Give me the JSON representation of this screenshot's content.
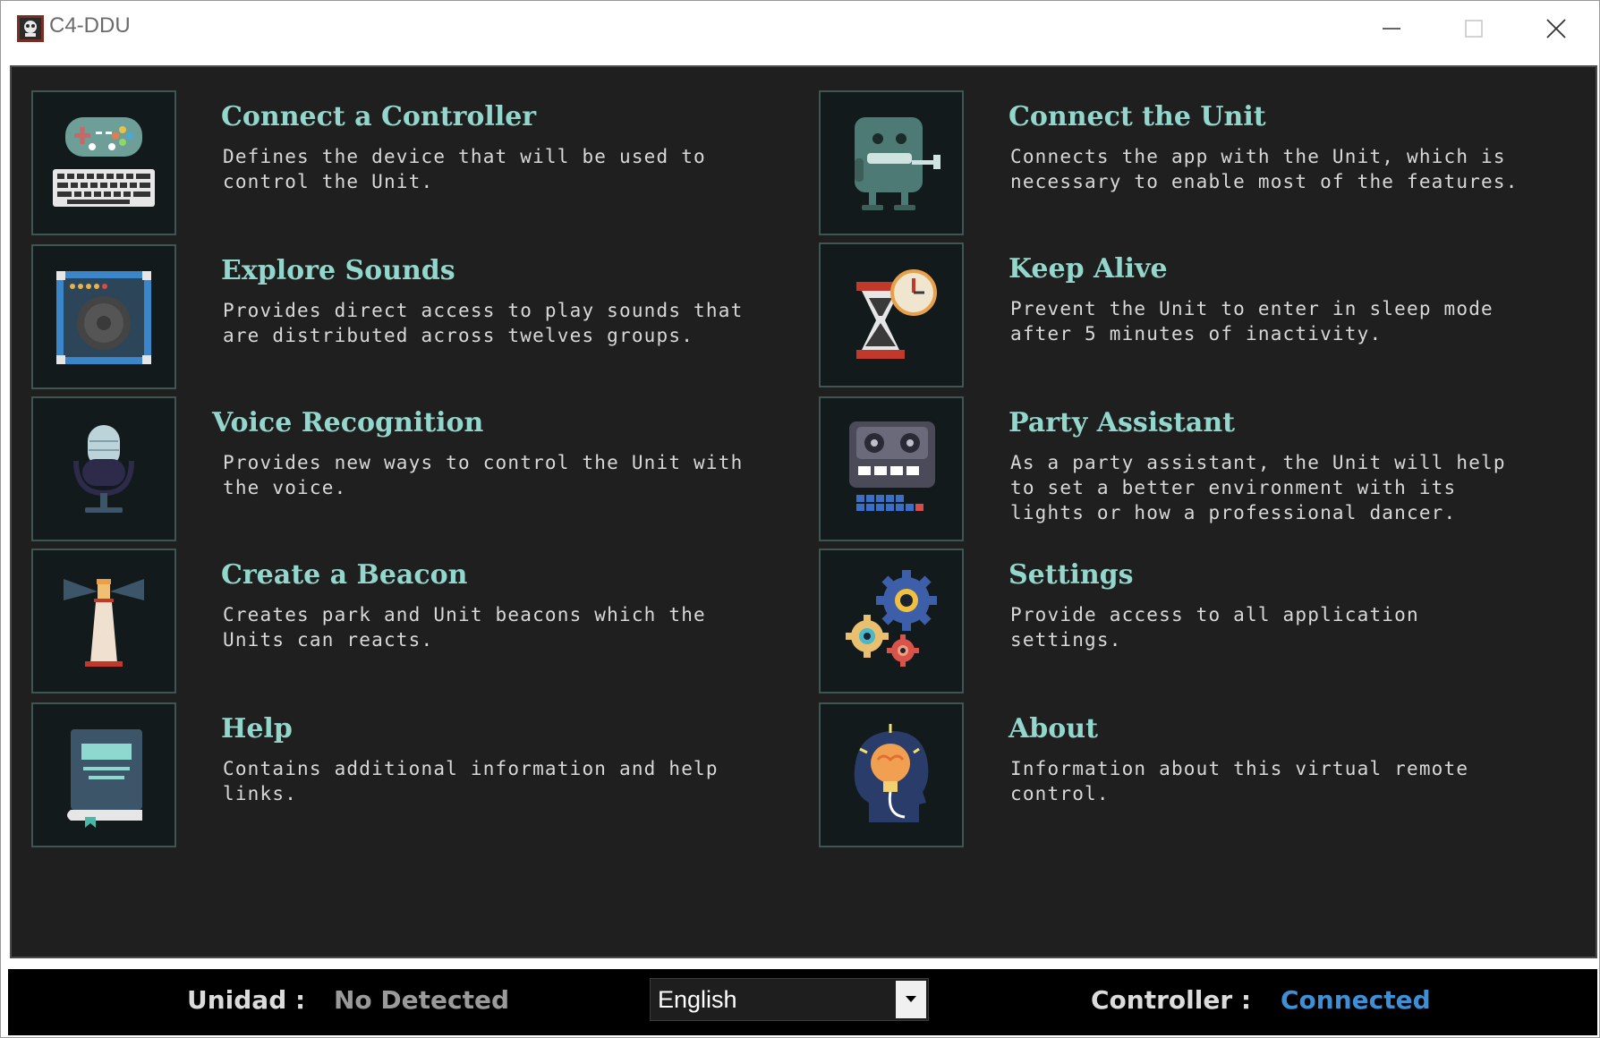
{
  "window": {
    "title": "C4-DDU"
  },
  "cards": [
    {
      "title": "Connect a Controller",
      "description": "Defines the device that will be used to\ncontrol the Unit.",
      "icon": "gamepad-keyboard-icon"
    },
    {
      "title": "Connect the Unit",
      "description": "Connects the app with the Unit, which is\nnecessary to enable most of the features.",
      "icon": "robot-unit-icon"
    },
    {
      "title": "Explore Sounds",
      "description": "Provides direct access to play sounds that\nare distributed across twelves groups.",
      "icon": "speaker-icon"
    },
    {
      "title": "Keep Alive",
      "description": "Prevent the Unit to enter in sleep mode\nafter 5 minutes of inactivity.",
      "icon": "hourglass-clock-icon"
    },
    {
      "title": "Voice Recognition",
      "description": "Provides new ways to control the Unit with\nthe voice.",
      "icon": "microphone-icon"
    },
    {
      "title": "Party Assistant",
      "description": "As a party assistant, the Unit will help\nto set a better environment with its\nlights or how a professional dancer.",
      "icon": "tape-recorder-icon"
    },
    {
      "title": "Create a Beacon",
      "description": "Creates park and Unit beacons which the\nUnits can reacts.",
      "icon": "lighthouse-icon"
    },
    {
      "title": "Settings",
      "description": "Provide access to all application\nsettings.",
      "icon": "gears-icon"
    },
    {
      "title": "Help",
      "description": "Contains additional information and help\nlinks.",
      "icon": "book-icon"
    },
    {
      "title": "About",
      "description": "Information about this virtual remote\ncontrol.",
      "icon": "head-lightbulb-icon"
    }
  ],
  "status": {
    "unit_label": "Unidad :",
    "unit_value": "No Detected",
    "language": "English",
    "controller_label": "Controller :",
    "controller_value": "Connected"
  },
  "colors": {
    "background": "#1f1f1f",
    "title_text": "#93d6cc",
    "description_text": "#d8d8d8",
    "icon_border": "#3e5552",
    "unit_value": "#9a9a9a",
    "controller_value": "#3d8fd6"
  }
}
